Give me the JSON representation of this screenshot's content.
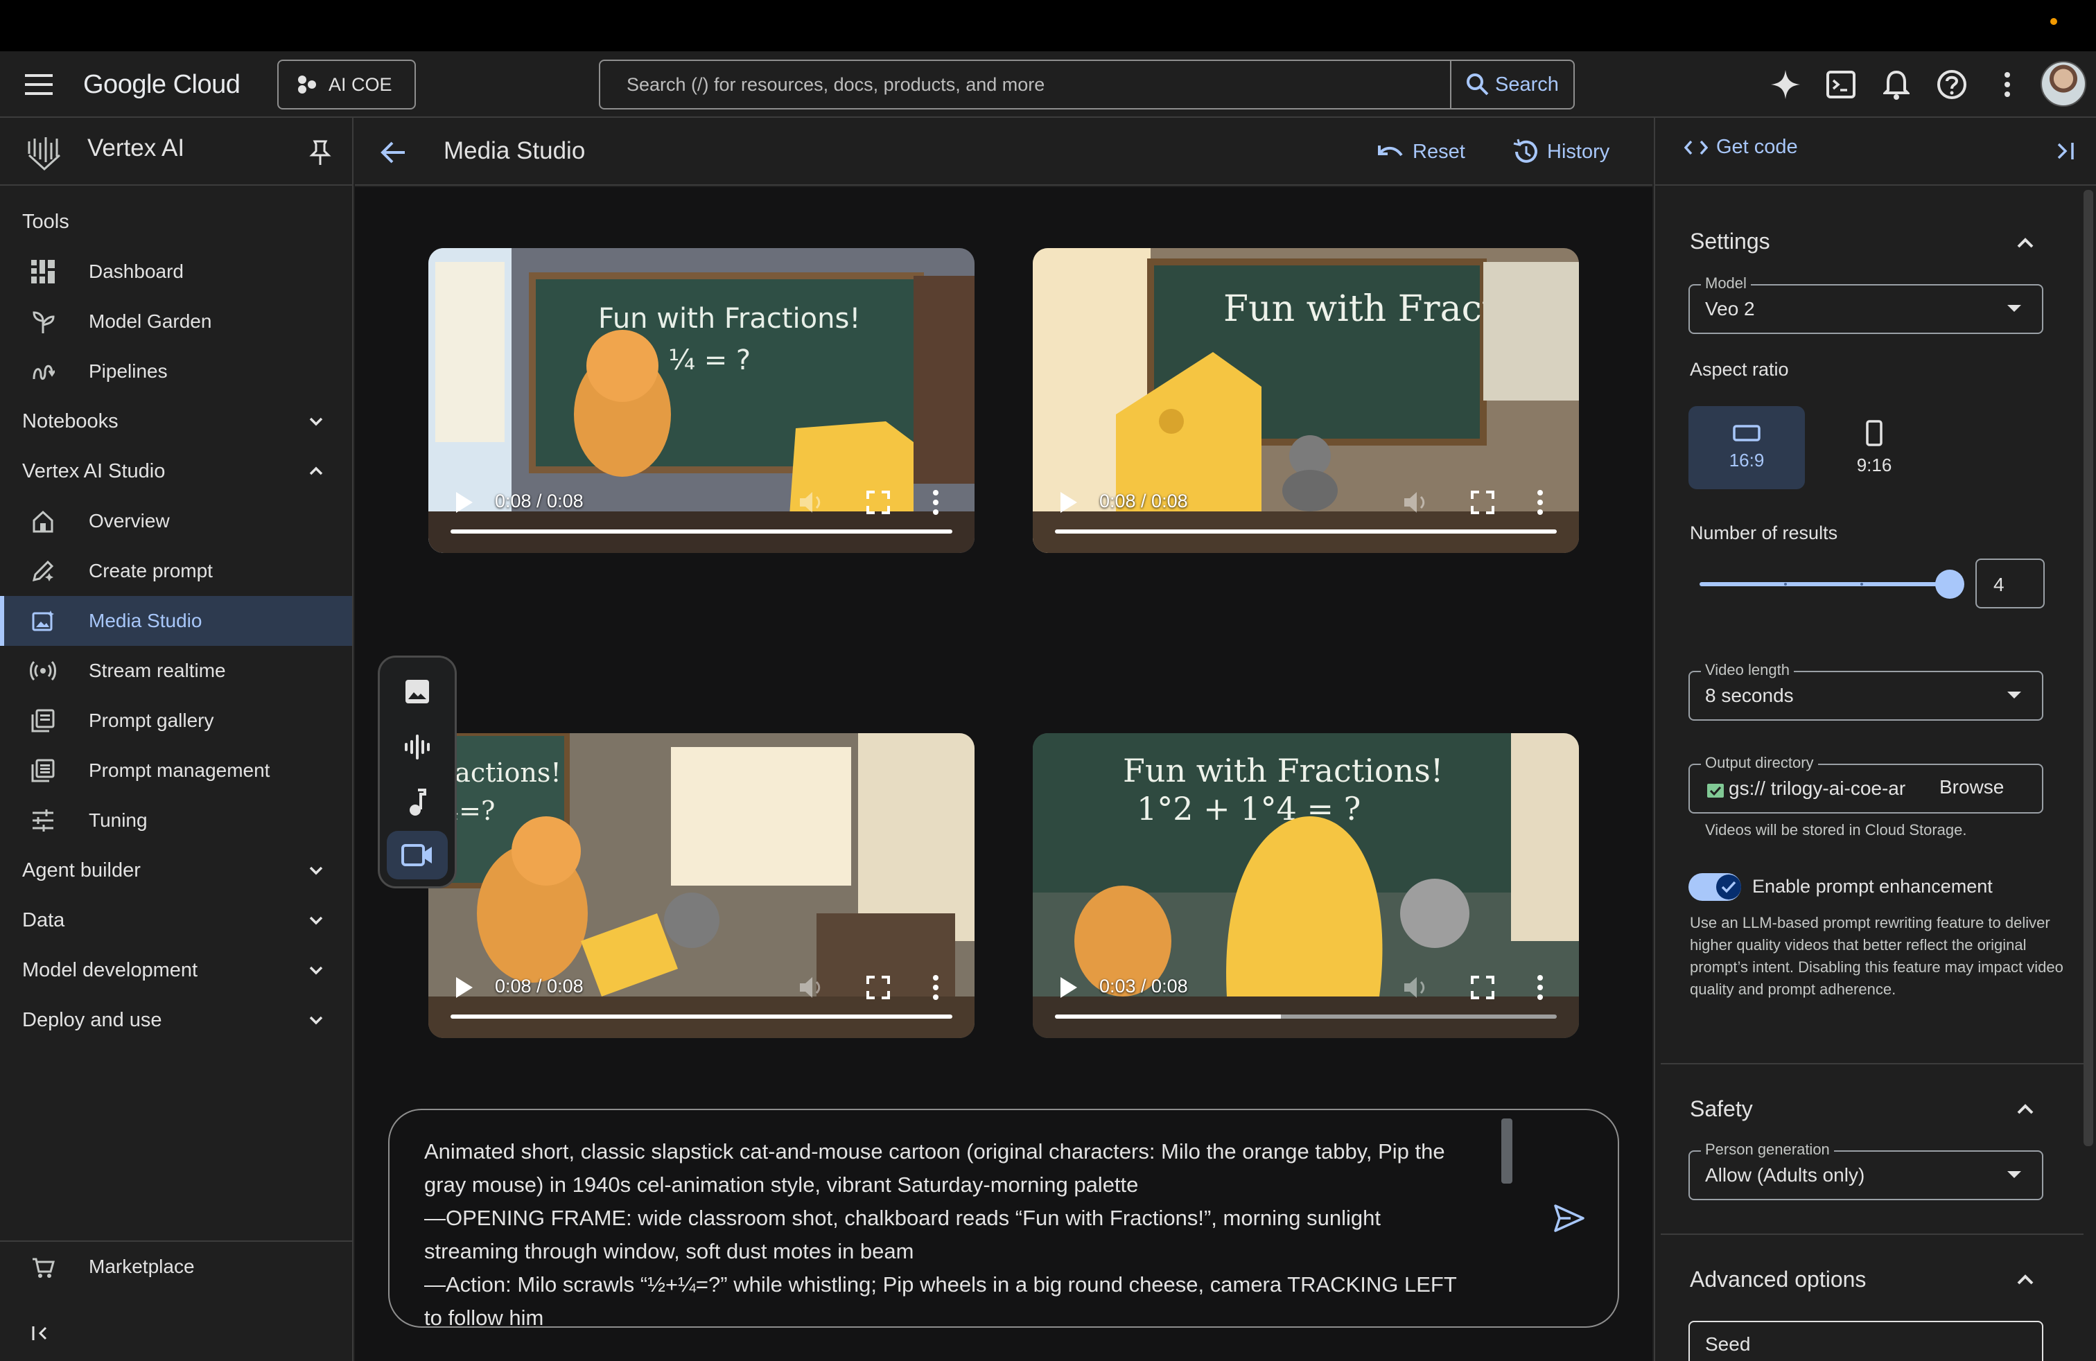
{
  "topbar": {
    "logo_text": "Google Cloud",
    "project": "AI COE",
    "search_placeholder": "Search (/) for resources, docs, products, and more",
    "search_button": "Search"
  },
  "leftnav": {
    "title": "Vertex AI",
    "tools_heading": "Tools",
    "tools": [
      {
        "label": "Dashboard",
        "icon": "dashboard-icon"
      },
      {
        "label": "Model Garden",
        "icon": "model-garden-icon"
      },
      {
        "label": "Pipelines",
        "icon": "pipelines-icon"
      }
    ],
    "notebooks": "Notebooks",
    "studio": "Vertex AI Studio",
    "studio_items": [
      {
        "label": "Overview",
        "icon": "home-icon"
      },
      {
        "label": "Create prompt",
        "icon": "edit-icon"
      },
      {
        "label": "Media Studio",
        "icon": "media-icon",
        "active": true
      },
      {
        "label": "Stream realtime",
        "icon": "stream-icon"
      },
      {
        "label": "Prompt gallery",
        "icon": "gallery-icon"
      },
      {
        "label": "Prompt management",
        "icon": "list-icon"
      },
      {
        "label": "Tuning",
        "icon": "tune-icon"
      }
    ],
    "groups": [
      "Agent builder",
      "Data",
      "Model development",
      "Deploy and use"
    ],
    "marketplace": "Marketplace"
  },
  "main_header": {
    "title": "Media Studio",
    "reset": "Reset",
    "history": "History"
  },
  "videos": [
    {
      "time": "0:08 / 0:08",
      "progress": 1.0
    },
    {
      "time": "0:08 / 0:08",
      "progress": 1.0
    },
    {
      "time": "0:08 / 0:08",
      "progress": 1.0
    },
    {
      "time": "0:03 / 0:08",
      "progress": 0.45
    }
  ],
  "video_board_text": [
    "Fun with Fractions!",
    "Fun with Fractions!",
    "ractions!",
    "Fun with Fractions!"
  ],
  "prompt": {
    "text": "Animated short, classic slapstick cat-and-mouse cartoon (original characters: Milo the orange tabby, Pip the gray mouse) in 1940s cel-animation style, vibrant Saturday-morning palette\n—OPENING FRAME: wide classroom shot, chalkboard reads “Fun with Fractions!”, morning sunlight streaming through window, soft dust motes in beam\n—Action: Milo scrawls “½+¼=?” while whistling; Pip wheels in a big round cheese, camera TRACKING LEFT to follow him"
  },
  "rpanel": {
    "get_code": "Get code",
    "settings": "Settings",
    "model_label": "Model",
    "model_value": "Veo 2",
    "aspect_label": "Aspect ratio",
    "aspect_options": [
      "16:9",
      "9:16"
    ],
    "aspect_selected": "16:9",
    "results_label": "Number of results",
    "results_value": "4",
    "results_max": 4,
    "video_length_label": "Video length",
    "video_length_value": "8 seconds",
    "output_label": "Output directory",
    "output_value": "gs:// trilogy-ai-coe-ar",
    "browse": "Browse",
    "output_help": "Videos will be stored in Cloud Storage.",
    "enhance_label": "Enable prompt enhancement",
    "enhance_on": true,
    "enhance_help": "Use an LLM-based prompt rewriting feature to deliver higher quality videos that better reflect the original prompt’s intent. Disabling this feature may impact video quality and prompt adherence.",
    "safety": "Safety",
    "person_label": "Person generation",
    "person_value": "Allow (Adults only)",
    "advanced": "Advanced options",
    "seed_label": "Seed"
  },
  "colors": {
    "accent": "#a8c7fa",
    "active_bg": "#2d3a4f",
    "bg": "#1f1f1f",
    "canvas": "#131314"
  }
}
